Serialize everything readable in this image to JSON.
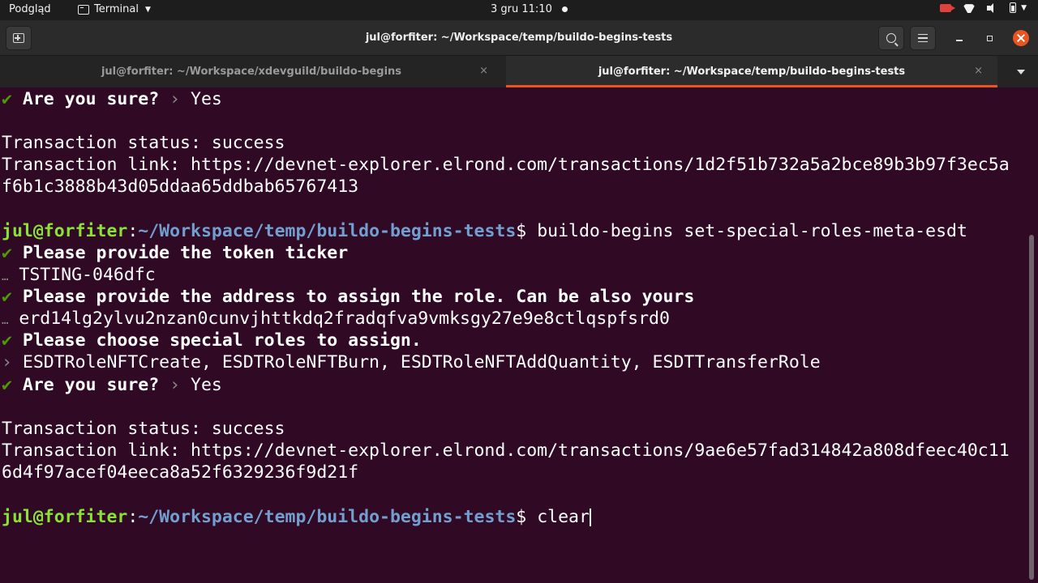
{
  "topbar": {
    "activities": "Podgląd",
    "app_menu": "Terminal",
    "clock": "3 gru  11:10"
  },
  "window": {
    "title": "jul@forfiter: ~/Workspace/temp/buildo-begins-tests"
  },
  "tabs": [
    {
      "label": "jul@forfiter: ~/Workspace/xdevguild/buildo-begins",
      "close": "×"
    },
    {
      "label": "jul@forfiter: ~/Workspace/temp/buildo-begins-tests",
      "close": "×"
    }
  ],
  "terminal": {
    "check_mark": "✔",
    "ellipsis_mark": "…",
    "arrow_mark": "›",
    "q_sure": "Are you sure?",
    "a_yes": "Yes",
    "status_label": "Transaction status: success",
    "link_label": "Transaction link: ",
    "tx1_line1": "https://devnet-explorer.elrond.com/transactions/1d2f51b732a5a2bce89b3b97f3ec5a",
    "tx1_line2": "f6b1c3888b43d05ddaa65ddbab65767413",
    "prompt_user": "jul@forfiter",
    "prompt_colon": ":",
    "prompt_path": "~/Workspace/temp/buildo-begins-tests",
    "prompt_dollar": "$ ",
    "cmd1": "buildo-begins set-special-roles-meta-esdt",
    "q_ticker": "Please provide the token ticker",
    "a_ticker": "TSTING-046dfc",
    "q_address": "Please provide the address to assign the role. Can be also yours",
    "a_address": "erd14lg2ylvu2nzan0cunvjhttkdq2fradqfva9vmksgy27e9e8ctlqspfsrd0",
    "q_roles": "Please choose special roles to assign.",
    "a_roles": "ESDTRoleNFTCreate, ESDTRoleNFTBurn, ESDTRoleNFTAddQuantity, ESDTTransferRole",
    "tx2_line1": "https://devnet-explorer.elrond.com/transactions/9ae6e57fad314842a808dfeec40c11",
    "tx2_line2": "6d4f97acef04eeca8a52f6329236f9d21f",
    "cmd2": "clear"
  }
}
